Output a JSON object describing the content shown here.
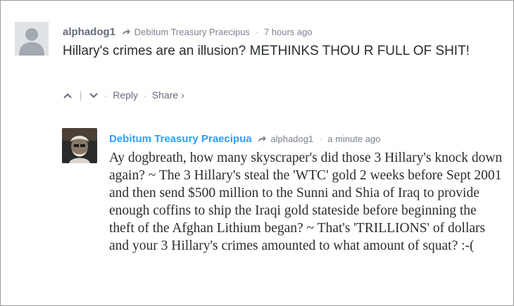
{
  "comments": [
    {
      "author": "alphadog1",
      "in_reply_to": "Debitum Treasury Praecipus",
      "time": "7 hours ago",
      "text": "Hillary's crimes are an illusion? METHINKS THOU R FULL OF SHIT!",
      "actions": {
        "reply": "Reply",
        "share": "Share ›"
      },
      "avatar": "default-avatar-icon"
    },
    {
      "author": "Debitum Treasury Praecipua",
      "in_reply_to": "alphadog1",
      "time": "a minute ago",
      "text": "Ay dogbreath, how many skyscraper's did those 3 Hillary's knock down again? ~ The 3 Hillary's steal the 'WTC' gold 2 weeks before Sept 2001 and then send $500 million to the Sunni and Shia of Iraq to provide enough coffins to ship the Iraqi gold stateside before beginning the theft of the Afghan Lithium began? ~ That's 'TRILLIONS' of dollars and your 3 Hillary's crimes amounted to what amount of squat? :-(",
      "avatar": "user-photo-avatar"
    }
  ],
  "separator": "·",
  "colors": {
    "author_link": "#2e9fff",
    "meta": "#656c7a",
    "text": "#2a2e2e"
  }
}
